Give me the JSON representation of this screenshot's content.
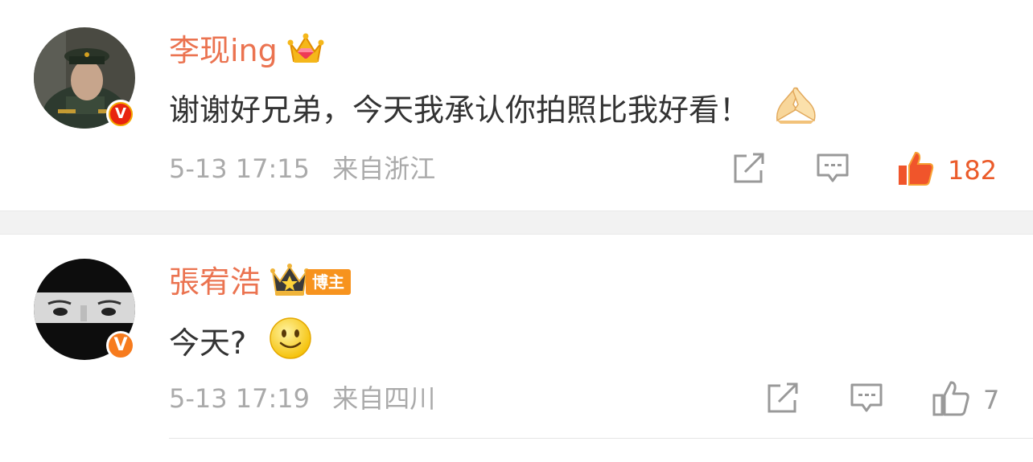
{
  "comments": [
    {
      "username": "李现ing",
      "text": "谢谢好兄弟，今天我承认你拍照比我好看！",
      "date": "5-13 17:15",
      "location": "来自浙江",
      "likes": "182",
      "liked": true,
      "verified_badge": "V",
      "user_badge_icon": "crown-gem-icon",
      "emoji_icon": "prayer-hands-icon"
    },
    {
      "username": "張宥浩",
      "text": "今天?",
      "date": "5-13 17:19",
      "location": "来自四川",
      "likes": "7",
      "liked": false,
      "verified_badge": "V",
      "user_badge_icon": "crown-star-icon",
      "user_tag": "博主",
      "emoji_icon": "smile-icon"
    }
  ],
  "colors": {
    "username": "#eb7350",
    "text": "#333333",
    "meta": "#aaaaaa",
    "liked": "#eb5b2a",
    "separator": "#f2f2f2"
  }
}
